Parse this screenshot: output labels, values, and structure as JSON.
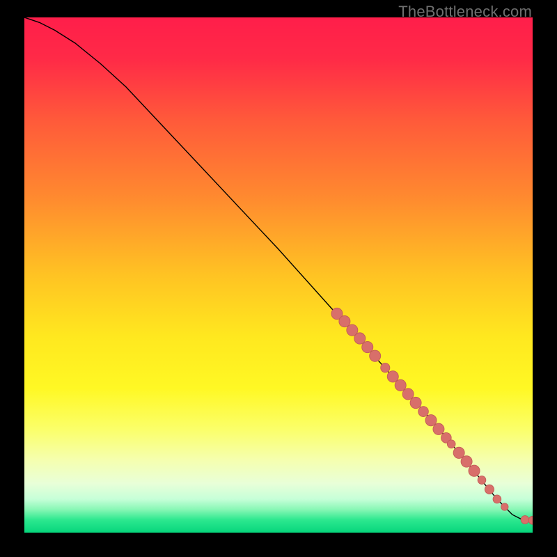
{
  "watermark": "TheBottleneck.com",
  "colors": {
    "gradient_stops": [
      {
        "offset": 0.0,
        "color": "#ff1e4a"
      },
      {
        "offset": 0.08,
        "color": "#ff2a47"
      },
      {
        "offset": 0.2,
        "color": "#ff5a3a"
      },
      {
        "offset": 0.35,
        "color": "#ff8a2f"
      },
      {
        "offset": 0.5,
        "color": "#ffc323"
      },
      {
        "offset": 0.62,
        "color": "#ffe81f"
      },
      {
        "offset": 0.72,
        "color": "#fff824"
      },
      {
        "offset": 0.8,
        "color": "#fbff6a"
      },
      {
        "offset": 0.86,
        "color": "#f5ffb0"
      },
      {
        "offset": 0.905,
        "color": "#e8ffd8"
      },
      {
        "offset": 0.935,
        "color": "#c6ffd8"
      },
      {
        "offset": 0.955,
        "color": "#88f7b5"
      },
      {
        "offset": 0.975,
        "color": "#2de88f"
      },
      {
        "offset": 1.0,
        "color": "#06d67c"
      }
    ],
    "line": "#000000",
    "marker_fill": "#d86f6a",
    "marker_stroke": "#c25b56"
  },
  "chart_data": {
    "type": "line",
    "title": "",
    "xlabel": "",
    "ylabel": "",
    "xlim": [
      0,
      100
    ],
    "ylim": [
      0,
      100
    ],
    "grid": false,
    "series": [
      {
        "name": "curve",
        "x": [
          0,
          3,
          6,
          10,
          15,
          20,
          30,
          40,
          50,
          60,
          70,
          80,
          88,
          93,
          96,
          98,
          100
        ],
        "y": [
          100,
          99,
          97.5,
          95,
          91,
          86.5,
          76,
          65.5,
          55,
          44,
          33,
          22,
          12.5,
          6.5,
          3.5,
          2.5,
          2.4
        ]
      }
    ],
    "markers": {
      "name": "highlighted-segment",
      "points": [
        {
          "x": 61.5,
          "y": 42.5,
          "r": 1.1
        },
        {
          "x": 63.0,
          "y": 41.0,
          "r": 1.1
        },
        {
          "x": 64.5,
          "y": 39.3,
          "r": 1.1
        },
        {
          "x": 66.0,
          "y": 37.7,
          "r": 1.1
        },
        {
          "x": 67.5,
          "y": 36.0,
          "r": 1.1
        },
        {
          "x": 69.0,
          "y": 34.3,
          "r": 1.1
        },
        {
          "x": 71.0,
          "y": 32.0,
          "r": 0.9
        },
        {
          "x": 72.5,
          "y": 30.3,
          "r": 1.1
        },
        {
          "x": 74.0,
          "y": 28.6,
          "r": 1.1
        },
        {
          "x": 75.5,
          "y": 26.9,
          "r": 1.1
        },
        {
          "x": 77.0,
          "y": 25.2,
          "r": 1.1
        },
        {
          "x": 78.5,
          "y": 23.5,
          "r": 1.0
        },
        {
          "x": 80.0,
          "y": 21.8,
          "r": 1.1
        },
        {
          "x": 81.5,
          "y": 20.1,
          "r": 1.1
        },
        {
          "x": 83.0,
          "y": 18.4,
          "r": 1.0
        },
        {
          "x": 84.0,
          "y": 17.2,
          "r": 0.8
        },
        {
          "x": 85.5,
          "y": 15.5,
          "r": 1.1
        },
        {
          "x": 87.0,
          "y": 13.8,
          "r": 1.1
        },
        {
          "x": 88.5,
          "y": 12.0,
          "r": 1.1
        },
        {
          "x": 90.0,
          "y": 10.2,
          "r": 0.8
        },
        {
          "x": 91.5,
          "y": 8.4,
          "r": 0.9
        },
        {
          "x": 93.0,
          "y": 6.5,
          "r": 0.8
        },
        {
          "x": 94.5,
          "y": 5.0,
          "r": 0.7
        },
        {
          "x": 98.5,
          "y": 2.5,
          "r": 0.8
        },
        {
          "x": 100.0,
          "y": 2.4,
          "r": 0.8
        }
      ]
    }
  }
}
